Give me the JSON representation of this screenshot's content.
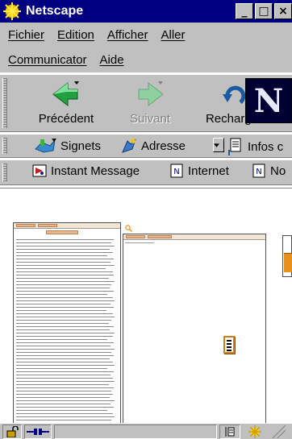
{
  "window": {
    "title": "Netscape"
  },
  "window_buttons": {
    "minimize": "_",
    "maximize": "□",
    "close": "×"
  },
  "menu": {
    "row1": [
      "Fichier",
      "Edition",
      "Afficher",
      "Aller"
    ],
    "row2": [
      "Communicator",
      "Aide"
    ]
  },
  "nav_toolbar": {
    "back_label": "Précédent",
    "forward_label": "Suivant",
    "reload_label": "Recharger"
  },
  "location_toolbar": {
    "bookmarks_label": "Signets",
    "address_label": "Adresse",
    "info_label": "Infos c"
  },
  "personal_toolbar": {
    "instant_message_label": "Instant Message",
    "internet_label": "Internet",
    "third_label": "No"
  },
  "colors": {
    "titlebar": "#000080",
    "chrome": "#c0c0c0",
    "accent_orange": "#e8901c",
    "logo_bg": "#000033"
  }
}
